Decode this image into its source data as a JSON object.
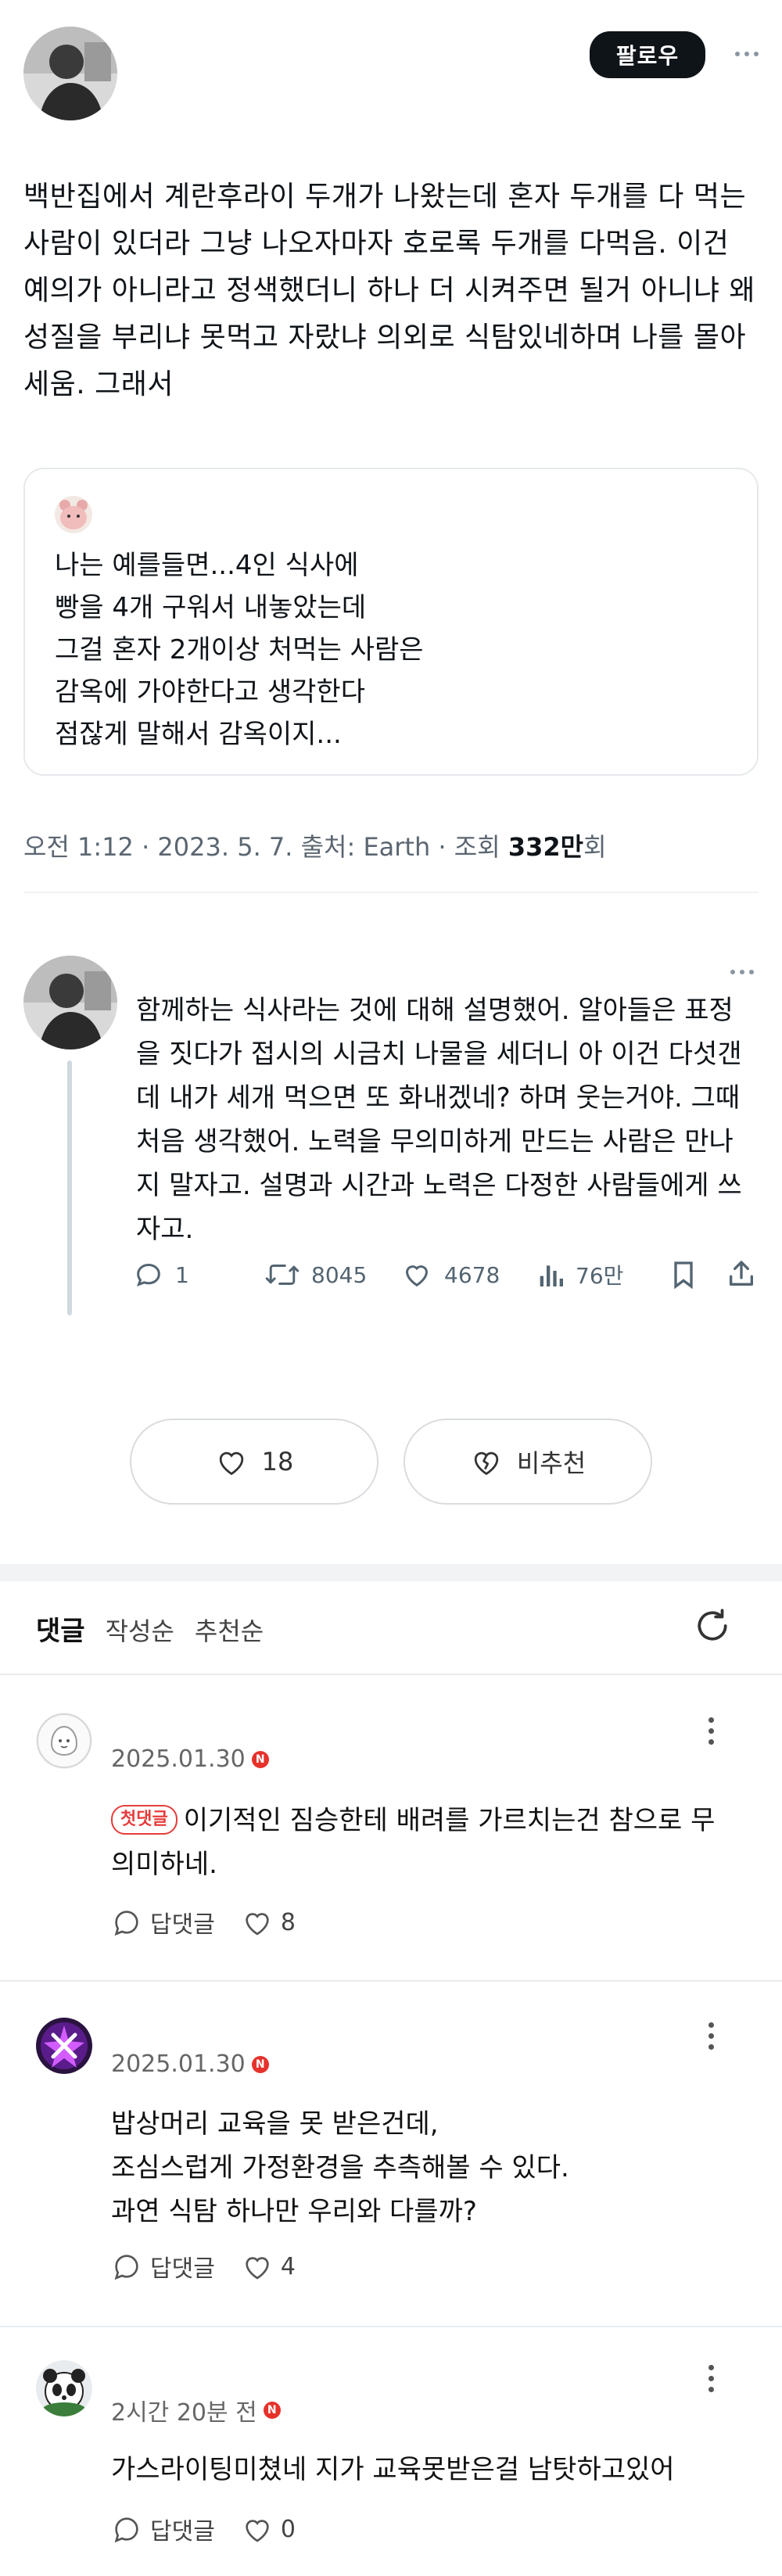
{
  "post": {
    "follow_label": "팔로우",
    "text": "백반집에서 계란후라이 두개가 나왔는데 혼자 두개를 다 먹는 사람이 있더라 그냥 나오자마자 호로록 두개를 다먹음. 이건 예의가 아니라고 정색했더니 하나 더 시켜주면 될거 아니냐 왜 성질을 부리냐 못먹고 자랐냐 의외로 식탐있네하며 나를 몰아세움. 그래서",
    "quote_lines": [
      "나는 예를들면...4인 식사에",
      "빵을 4개 구워서 내놓았는데",
      "그걸 혼자 2개이상 처먹는 사람은",
      "감옥에 가야한다고 생각한다",
      "점잖게 말해서 감옥이지..."
    ],
    "meta_prefix": "오전 1:12 · 2023. 5. 7. 출처: Earth · 조회 ",
    "views_number": "332만",
    "views_suffix": "회"
  },
  "reply": {
    "text": "함께하는 식사라는 것에 대해 설명했어. 알아들은 표정을 짓다가 접시의 시금치 나물을 세더니 아 이건 다섯갠데 내가 세개 먹으면 또 화내겠네? 하며 웃는거야. 그때 처음 생각했어. 노력을 무의미하게 만드는 사람은 만나지 말자고. 설명과 시간과 노력은 다정한 사람들에게 쓰자고.",
    "replies": "1",
    "retweets": "8045",
    "likes": "4678",
    "views": "76만"
  },
  "votes": {
    "like_count": "18",
    "dislike_label": "비추천"
  },
  "comments_header": {
    "title": "댓글",
    "sort_by_date": "작성순",
    "sort_by_likes": "추천순"
  },
  "comments": [
    {
      "date": "2025.01.30",
      "badge": "첫댓글",
      "text": "이기적인 짐승한테 배려를 가르치는건 참으로 무의미하네.",
      "reply_label": "답댓글",
      "likes": "8"
    },
    {
      "date": "2025.01.30",
      "text": "밥상머리 교육을 못 받은건데,\n조심스럽게 가정환경을 추측해볼 수 있다.\n과연 식탐 하나만 우리와 다를까?",
      "reply_label": "답댓글",
      "likes": "4"
    },
    {
      "date": "2시간 20분 전",
      "text": "가스라이팅미쳤네 지가 교육못받은걸 남탓하고있어",
      "reply_label": "답댓글",
      "likes": "0"
    }
  ],
  "naver_badge": "N",
  "colors": {
    "follow_bg": "#0f1419",
    "badge_red": "#e6322b",
    "divider": "#eff3f4",
    "section_gap": "#f1f3f5"
  }
}
